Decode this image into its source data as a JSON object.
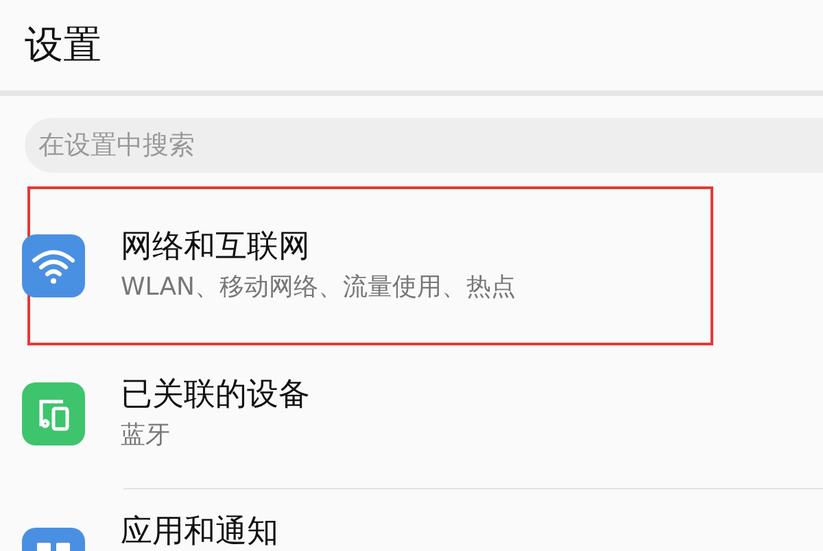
{
  "title": "设置",
  "search": {
    "placeholder": "在设置中搜索"
  },
  "items": [
    {
      "kind": "wifi",
      "color": "#4a90e2",
      "title": "网络和互联网",
      "subtitle": "WLAN、移动网络、流量使用、热点",
      "highlighted": true
    },
    {
      "kind": "devices",
      "color": "#3ec46d",
      "title": "已关联的设备",
      "subtitle": "蓝牙",
      "highlighted": false
    },
    {
      "kind": "apps",
      "color": "#4a90e2",
      "title": "应用和通知",
      "highlighted": false
    }
  ]
}
